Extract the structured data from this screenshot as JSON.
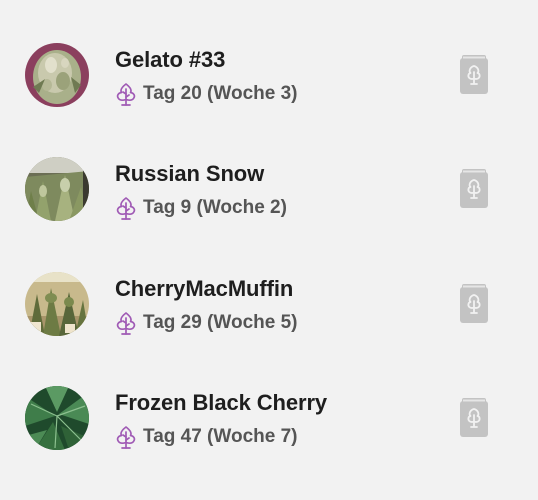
{
  "colors": {
    "background": "#f2f2f2",
    "name_text": "#1e1e1e",
    "age_text": "#555555",
    "plant_icon": "#a05bb5",
    "diary_icon": "#c3c3c3"
  },
  "plants": [
    {
      "name": "Gelato #33",
      "age": "Tag 20 (Woche 3)",
      "icon": "plant-icon",
      "action_icon": "diary-book-icon"
    },
    {
      "name": "Russian Snow",
      "age": "Tag 9 (Woche 2)",
      "icon": "plant-icon",
      "action_icon": "diary-book-icon"
    },
    {
      "name": "CherryMacMuffin",
      "age": "Tag 29 (Woche 5)",
      "icon": "plant-icon",
      "action_icon": "diary-book-icon"
    },
    {
      "name": "Frozen Black Cherry",
      "age": "Tag 47 (Woche 7)",
      "icon": "plant-icon",
      "action_icon": "diary-book-icon"
    }
  ]
}
